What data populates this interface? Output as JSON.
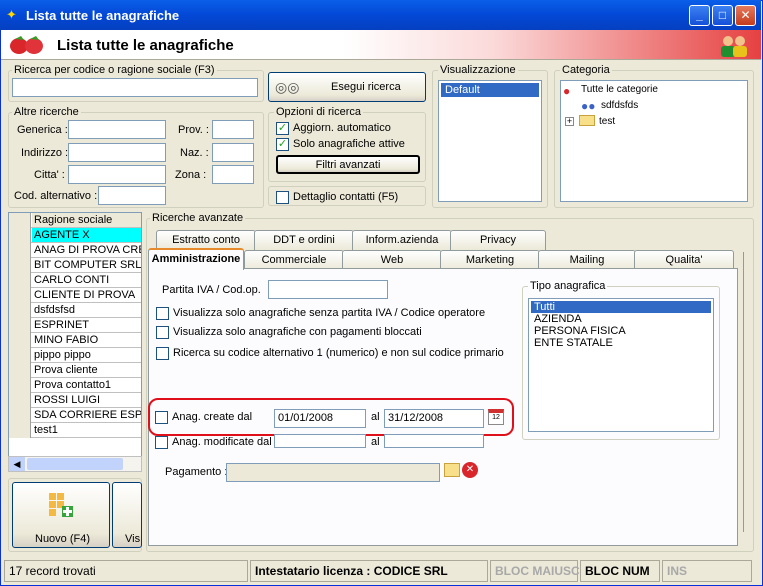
{
  "window": {
    "title": "Lista tutte le anagrafiche"
  },
  "banner": {
    "title": "Lista tutte le anagrafiche"
  },
  "search": {
    "label": "Ricerca per codice o ragione sociale (F3)",
    "value": "",
    "button": "Esegui ricerca"
  },
  "altre": {
    "label": "Altre ricerche",
    "generica": "Generica :",
    "indirizzo": "Indirizzo :",
    "citta": "Citta' :",
    "cod_alt": "Cod. alternativo :",
    "prov": "Prov. :",
    "naz": "Naz. :",
    "zona": "Zona :"
  },
  "opzioni": {
    "label": "Opzioni di ricerca",
    "aggiorn": "Aggiorn. automatico",
    "solo_attive": "Solo anagrafiche attive",
    "filtri": "Filtri avanzati"
  },
  "dettaglio": "Dettaglio contatti (F5)",
  "visualizzazione": {
    "label": "Visualizzazione",
    "items": [
      "Default"
    ]
  },
  "categoria": {
    "label": "Categoria",
    "items": [
      "Tutte le categorie",
      "sdfdsfds",
      "test"
    ]
  },
  "grid": {
    "header": "Ragione sociale",
    "rows": [
      "AGENTE X",
      "ANAG DI PROVA CRE",
      "BIT COMPUTER SRL",
      "CARLO CONTI",
      "CLIENTE DI PROVA",
      "dsfdsfsd",
      "ESPRINET",
      "MINO FABIO",
      "pippo pippo",
      "Prova cliente",
      "Prova contatto1",
      "ROSSI LUIGI",
      "SDA CORRIERE ESPF",
      "test1"
    ]
  },
  "buttons": {
    "nuovo": "Nuovo (F4)",
    "vis": "Vis"
  },
  "avanzate": {
    "label": "Ricerche avanzate",
    "tabs_back": [
      "Estratto conto",
      "DDT e ordini",
      "Inform.azienda",
      "Privacy"
    ],
    "tabs_front": [
      "Amministrazione",
      "Commerciale",
      "Web",
      "Marketing",
      "Mailing",
      "Qualita'"
    ],
    "partita_iva": "Partita IVA / Cod.op.",
    "chk1": "Visualizza solo anagrafiche senza partita IVA / Codice operatore",
    "chk2": "Visualizza solo anagrafiche con pagamenti bloccati",
    "chk3": "Ricerca su codice alternativo 1 (numerico)  e non sul codice primario",
    "create_label": "Anag. create dal",
    "create_from": "01/01/2008",
    "create_al": "al",
    "create_to": "31/12/2008",
    "mod_label": "Anag. modificate dal",
    "mod_al": "al",
    "pagamento": "Pagamento :",
    "tipo_label": "Tipo anagrafica",
    "tipo_items": [
      "Tutti",
      "AZIENDA",
      "PERSONA FISICA",
      "ENTE STATALE"
    ]
  },
  "status": {
    "records": "17 record trovati",
    "licenza": "Intestatario licenza : CODICE SRL",
    "maiusc": "BLOC MAIUSC",
    "num": "BLOC NUM",
    "ins": "INS"
  }
}
